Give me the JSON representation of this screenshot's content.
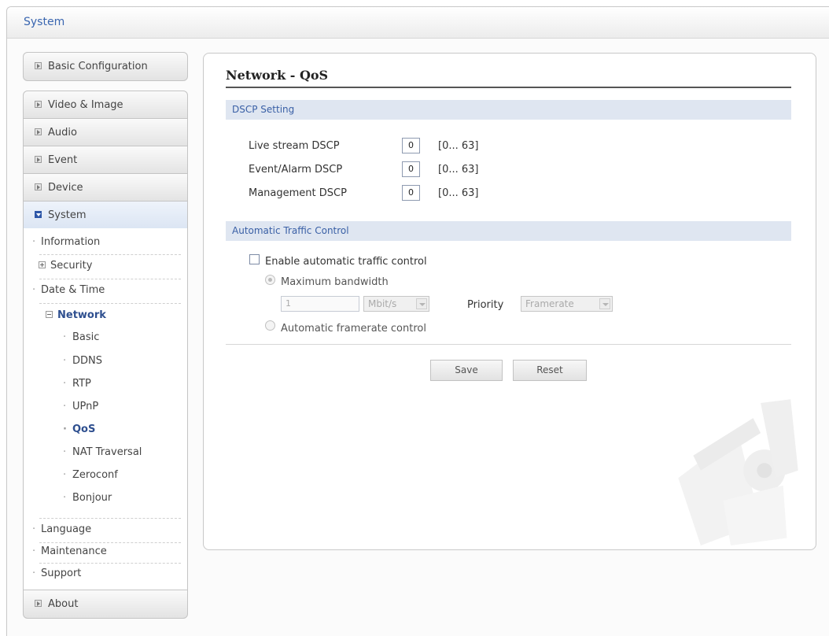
{
  "header": {
    "title": "System"
  },
  "sidebar": {
    "basic_configuration": "Basic Configuration",
    "video_image": "Video & Image",
    "audio": "Audio",
    "event": "Event",
    "device": "Device",
    "system": "System",
    "about": "About",
    "system_items": {
      "information": "Information",
      "security": "Security",
      "date_time": "Date & Time",
      "network": "Network",
      "language": "Language",
      "maintenance": "Maintenance",
      "support": "Support"
    },
    "network_items": [
      "Basic",
      "DDNS",
      "RTP",
      "UPnP",
      "QoS",
      "NAT Traversal",
      "Zeroconf",
      "Bonjour"
    ]
  },
  "page": {
    "title": "Network - QoS",
    "dscp": {
      "section_title": "DSCP Setting",
      "live_stream_label": "Live stream DSCP",
      "live_stream_value": "0",
      "event_alarm_label": "Event/Alarm DSCP",
      "event_alarm_value": "0",
      "management_label": "Management DSCP",
      "management_value": "0",
      "range_hint": "[0... 63]"
    },
    "traffic": {
      "section_title": "Automatic Traffic Control",
      "enable_label": "Enable automatic traffic control",
      "enable_checked": false,
      "max_bandwidth_label": "Maximum bandwidth",
      "bandwidth_value": "1",
      "unit_value": "Mbit/s",
      "priority_label": "Priority",
      "priority_value": "Framerate",
      "auto_framerate_label": "Automatic framerate control",
      "selected_mode": "Maximum bandwidth"
    },
    "buttons": {
      "save": "Save",
      "reset": "Reset"
    }
  },
  "colors": {
    "accent": "#3a66b0",
    "section_bg": "#dfe6f1",
    "active_nav": "#2e4f8f"
  }
}
